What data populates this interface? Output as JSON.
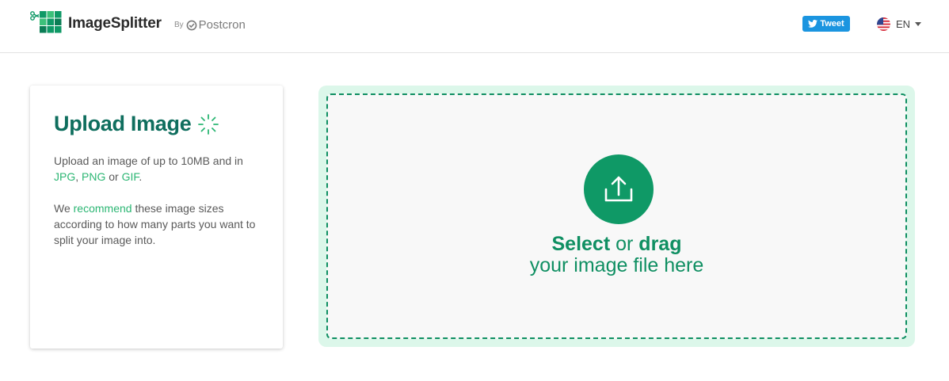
{
  "header": {
    "app_name": "ImageSplitter",
    "by_label": "By",
    "partner_name": "Postcron",
    "tweet_label": "Tweet",
    "language": "EN"
  },
  "card": {
    "title": "Upload Image",
    "p1_text1": "Upload an image of up to 10MB and in ",
    "format_jpg": "JPG",
    "sep1": ", ",
    "format_png": "PNG",
    "sep2": " or ",
    "format_gif": "GIF",
    "sep3": ".",
    "p2_text1": "We ",
    "recommend_link": "recommend",
    "p2_text2": " these image sizes according to how many parts you want to split your image into."
  },
  "dropzone": {
    "select_label": "Select",
    "or_label": " or ",
    "drag_label": "drag",
    "line2": "your image file here"
  },
  "colors": {
    "brand_green": "#0f9966",
    "title_teal": "#0f6e5e",
    "link_green": "#2bb673",
    "dropzone_bg": "#dcf7ea",
    "tweet_blue": "#1b95e0"
  },
  "icons": {
    "logo": "scissors-grid-logo-icon",
    "partner": "postcron-logo-icon",
    "tweet": "twitter-bird-icon",
    "flag": "us-flag-icon",
    "spinner": "loading-spinner-icon",
    "upload": "upload-icon"
  }
}
